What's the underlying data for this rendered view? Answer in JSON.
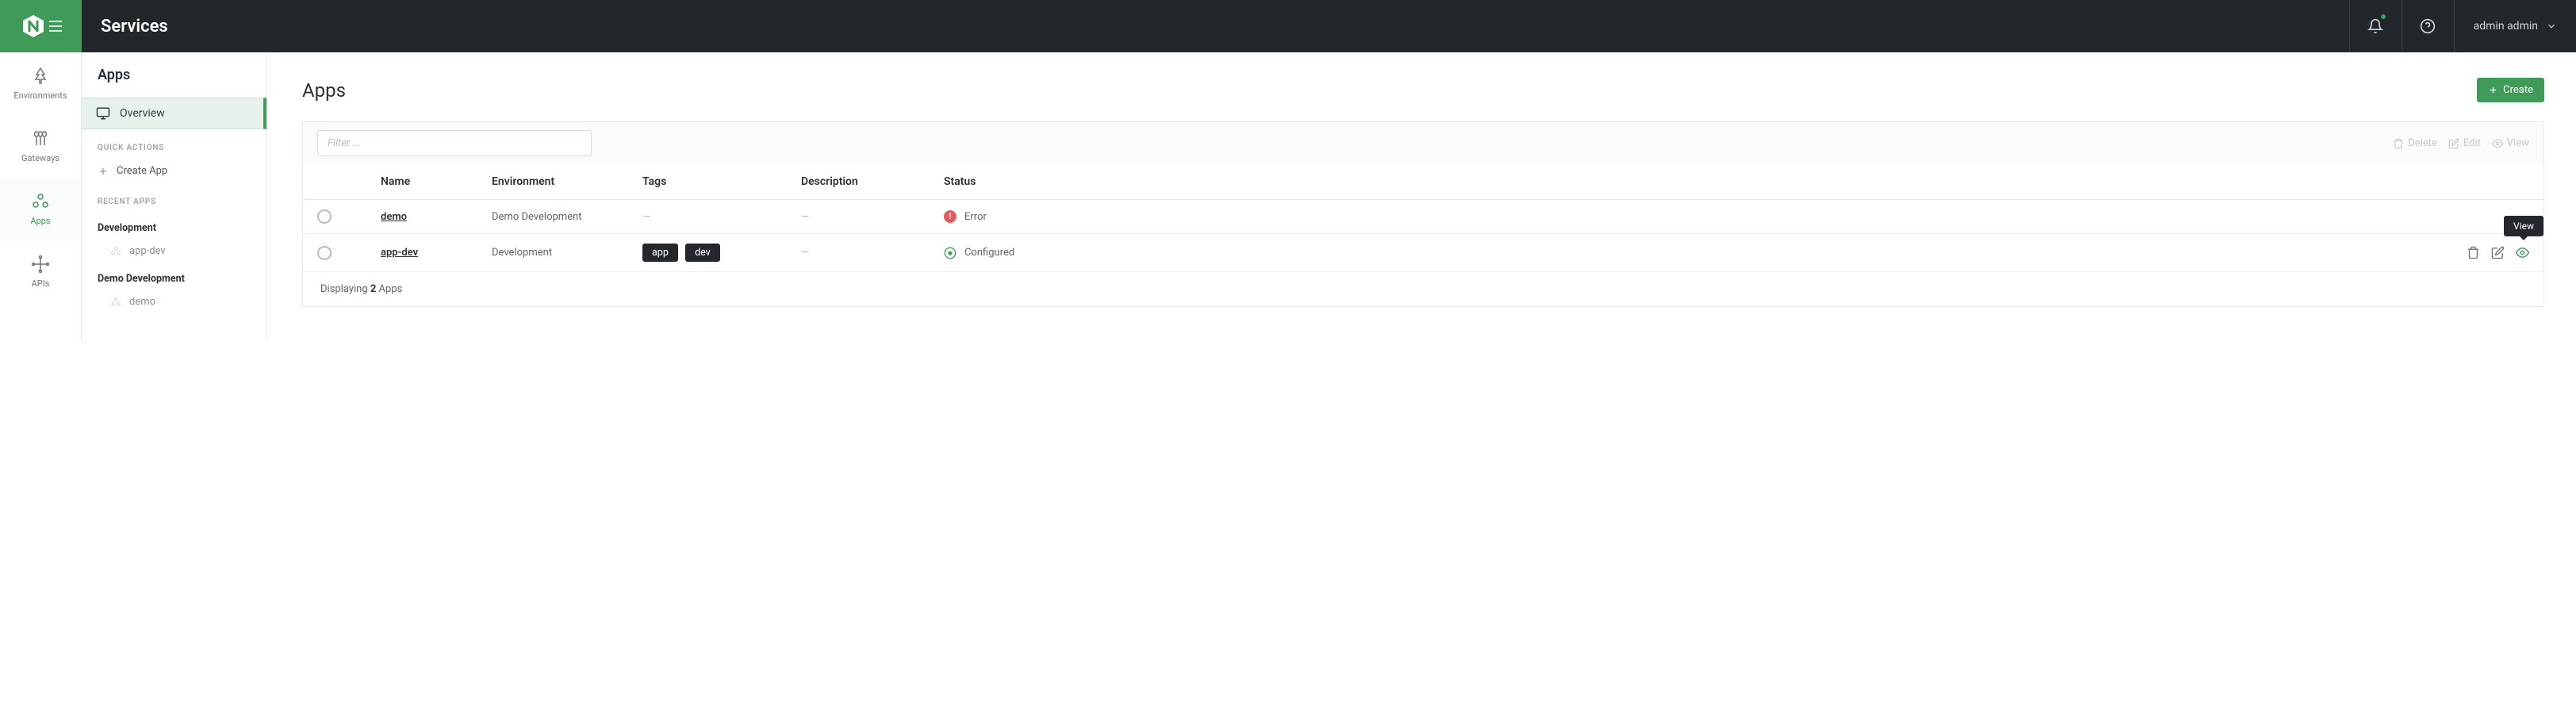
{
  "topbar": {
    "title": "Services",
    "user": "admin admin"
  },
  "rail": {
    "environments": "Environments",
    "gateways": "Gateways",
    "apps": "Apps",
    "apis": "APIs"
  },
  "sidepanel": {
    "title": "Apps",
    "overview": "Overview",
    "quick_actions_label": "Quick actions",
    "create_app": "Create App",
    "recent_apps_label": "Recent apps",
    "groups": [
      {
        "name": "Development",
        "items": [
          "app-dev"
        ]
      },
      {
        "name": "Demo Development",
        "items": [
          "demo"
        ]
      }
    ]
  },
  "main": {
    "title": "Apps",
    "create_label": "Create",
    "filter_placeholder": "Filter ...",
    "actions": {
      "delete": "Delete",
      "edit": "Edit",
      "view": "View"
    },
    "columns": {
      "name": "Name",
      "environment": "Environment",
      "tags": "Tags",
      "description": "Description",
      "status": "Status"
    },
    "rows": [
      {
        "name": "demo",
        "environment": "Demo Development",
        "tags": [],
        "description": "—",
        "status": "Error",
        "status_type": "error"
      },
      {
        "name": "app-dev",
        "environment": "Development",
        "tags": [
          "app",
          "dev"
        ],
        "description": "—",
        "status": "Configured",
        "status_type": "ok"
      }
    ],
    "footer_prefix": "Displaying ",
    "footer_count": "2",
    "footer_suffix": " Apps",
    "tooltip_view": "View"
  }
}
